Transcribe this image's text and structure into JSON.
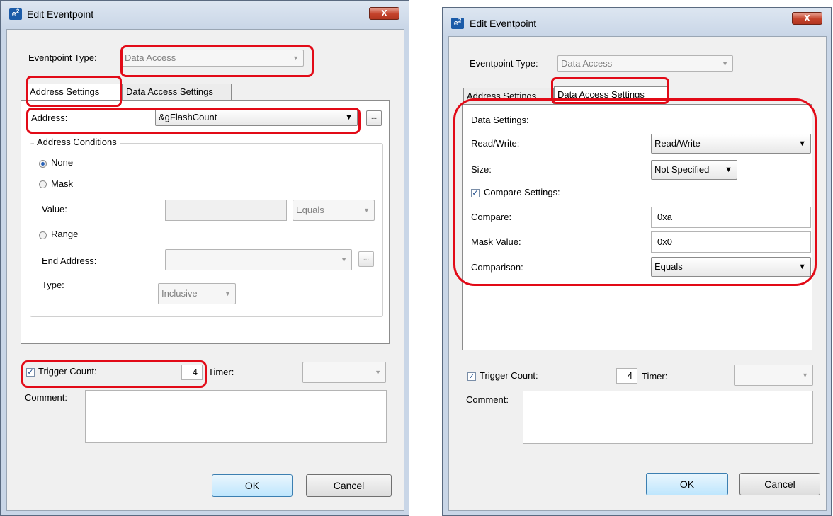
{
  "left_dialog": {
    "title": "Edit Eventpoint",
    "close_glyph": "X",
    "logo_text": "e",
    "logo_sup": "2",
    "eventpoint_type_label": "Eventpoint Type:",
    "eventpoint_type_value": "Data Access",
    "tabs": [
      "Address Settings",
      "Data Access Settings"
    ],
    "address_label": "Address:",
    "address_value": "&gFlashCount",
    "ellipsis": "...",
    "address_conditions_label": "Address Conditions",
    "radio_none": "None",
    "radio_mask": "Mask",
    "value_label": "Value:",
    "value_value": "",
    "mask_compare_value": "Equals",
    "radio_range": "Range",
    "end_address_label": "End Address:",
    "end_address_value": "",
    "type_label": "Type:",
    "type_value": "Inclusive",
    "trigger_count_label": "Trigger Count:",
    "trigger_count_value": "4",
    "trigger_count_checked": true,
    "timer_label": "Timer:",
    "timer_value": "",
    "comment_label": "Comment:",
    "comment_value": "",
    "ok_label": "OK",
    "cancel_label": "Cancel"
  },
  "right_dialog": {
    "title": "Edit Eventpoint",
    "close_glyph": "X",
    "logo_text": "e",
    "logo_sup": "2",
    "eventpoint_type_label": "Eventpoint Type:",
    "eventpoint_type_value": "Data Access",
    "tabs": [
      "Address Settings",
      "Data Access Settings"
    ],
    "data_settings_label": "Data Settings:",
    "read_write_label": "Read/Write:",
    "read_write_value": "Read/Write",
    "size_label": "Size:",
    "size_value": "Not Specified",
    "compare_settings_label": "Compare Settings:",
    "compare_settings_checked": true,
    "compare_label": "Compare:",
    "compare_value": "0xa",
    "mask_value_label": "Mask Value:",
    "mask_value_value": "0x0",
    "comparison_label": "Comparison:",
    "comparison_value": "Equals",
    "trigger_count_label": "Trigger Count:",
    "trigger_count_value": "4",
    "trigger_count_checked": true,
    "timer_label": "Timer:",
    "timer_value": "",
    "comment_label": "Comment:",
    "comment_value": "",
    "ok_label": "OK",
    "cancel_label": "Cancel"
  },
  "icons": {
    "dropdown": "dropdown-arrow-icon",
    "check": "checkmark-icon",
    "radio": "radio-icon",
    "close": "close-icon"
  },
  "colors": {
    "highlight": "#e20a17",
    "title_bar": "#c9d6e7",
    "close_button": "#c4422b",
    "default_button_border": "#3c7fb1"
  }
}
